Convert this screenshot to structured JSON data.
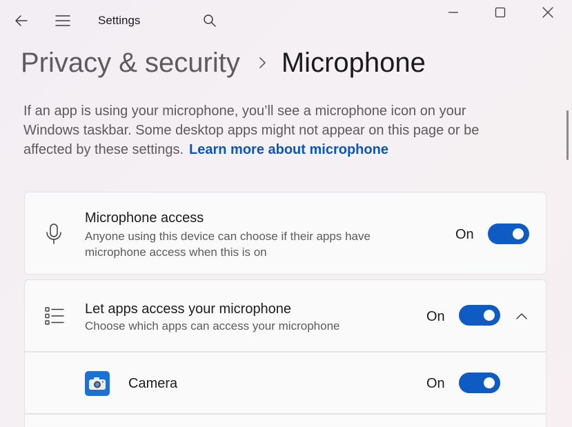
{
  "window": {
    "app_title": "Settings",
    "icons": {
      "back": "back-arrow-icon",
      "menu": "hamburger-menu-icon",
      "search": "search-icon",
      "minimize": "minimize-icon",
      "maximize": "maximize-icon",
      "close": "close-icon"
    }
  },
  "breadcrumb": {
    "parent": "Privacy & security",
    "separator_icon": "chevron-right-icon",
    "current": "Microphone"
  },
  "description": {
    "text": "If an app is using your microphone, you’ll see a microphone icon on your Windows taskbar. Some desktop apps might not appear on this page or be affected by these settings.",
    "link": "Learn more about microphone"
  },
  "settings": [
    {
      "icon": "microphone-icon",
      "title": "Microphone access",
      "subtitle": "Anyone using this device can choose if their apps have microphone access when this is on",
      "state": "On",
      "toggle_on": true
    },
    {
      "icon": "list-bullets-icon",
      "title": "Let apps access your microphone",
      "subtitle": "Choose which apps can access your microphone",
      "state": "On",
      "toggle_on": true,
      "expand_icon": "chevron-up-icon"
    }
  ],
  "apps": [
    {
      "icon": "camera-app-icon",
      "name": "Camera",
      "state": "On",
      "toggle_on": true
    }
  ],
  "colors": {
    "accent": "#0e5bc4",
    "link": "#0b56b8",
    "background": "#f3eff3",
    "card": "#fbfafb"
  }
}
